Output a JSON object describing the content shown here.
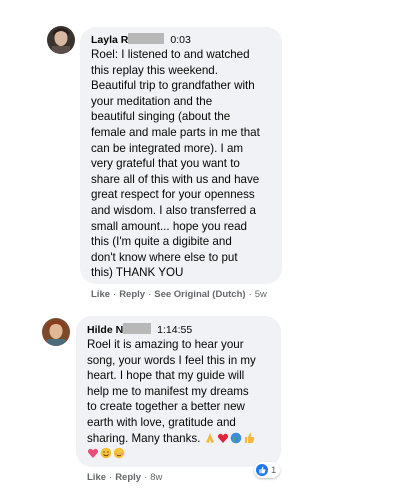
{
  "comments": [
    {
      "author": "Layla R",
      "time": "0:03",
      "lines": [
        "Roel: I listened to and watched",
        "this replay this weekend.",
        "Beautiful trip to grandfather with",
        "your meditation and the",
        "beautiful singing (about the",
        "female and male parts in me that",
        "can be integrated more). I am",
        "very grateful that you want to",
        "share all of this with us and have",
        "great respect for your openness",
        "and wisdom. I also transferred a",
        "small amount... hope you read",
        "this (I'm quite a digibite and",
        "don't know where else to put",
        "this) THANK YOU"
      ],
      "actions": {
        "like": "Like",
        "reply": "Reply",
        "see_original": "See Original (Dutch)",
        "age": "5w"
      }
    },
    {
      "author": "Hilde N",
      "time": "1:14:55",
      "lines": [
        "Roel it is amazing to hear your",
        "song, your words I feel this in my",
        "heart. I hope that my guide will",
        "help me to manifest my dreams",
        "to create together a better new",
        "earth with love, gratitude and",
        "sharing. Many thanks."
      ],
      "reaction_count": "1",
      "actions": {
        "like": "Like",
        "reply": "Reply",
        "age": "8w"
      }
    }
  ],
  "colors": {
    "bubble": "#f0f2f5",
    "meta": "#65676b",
    "like_blue": "#1877f2"
  }
}
